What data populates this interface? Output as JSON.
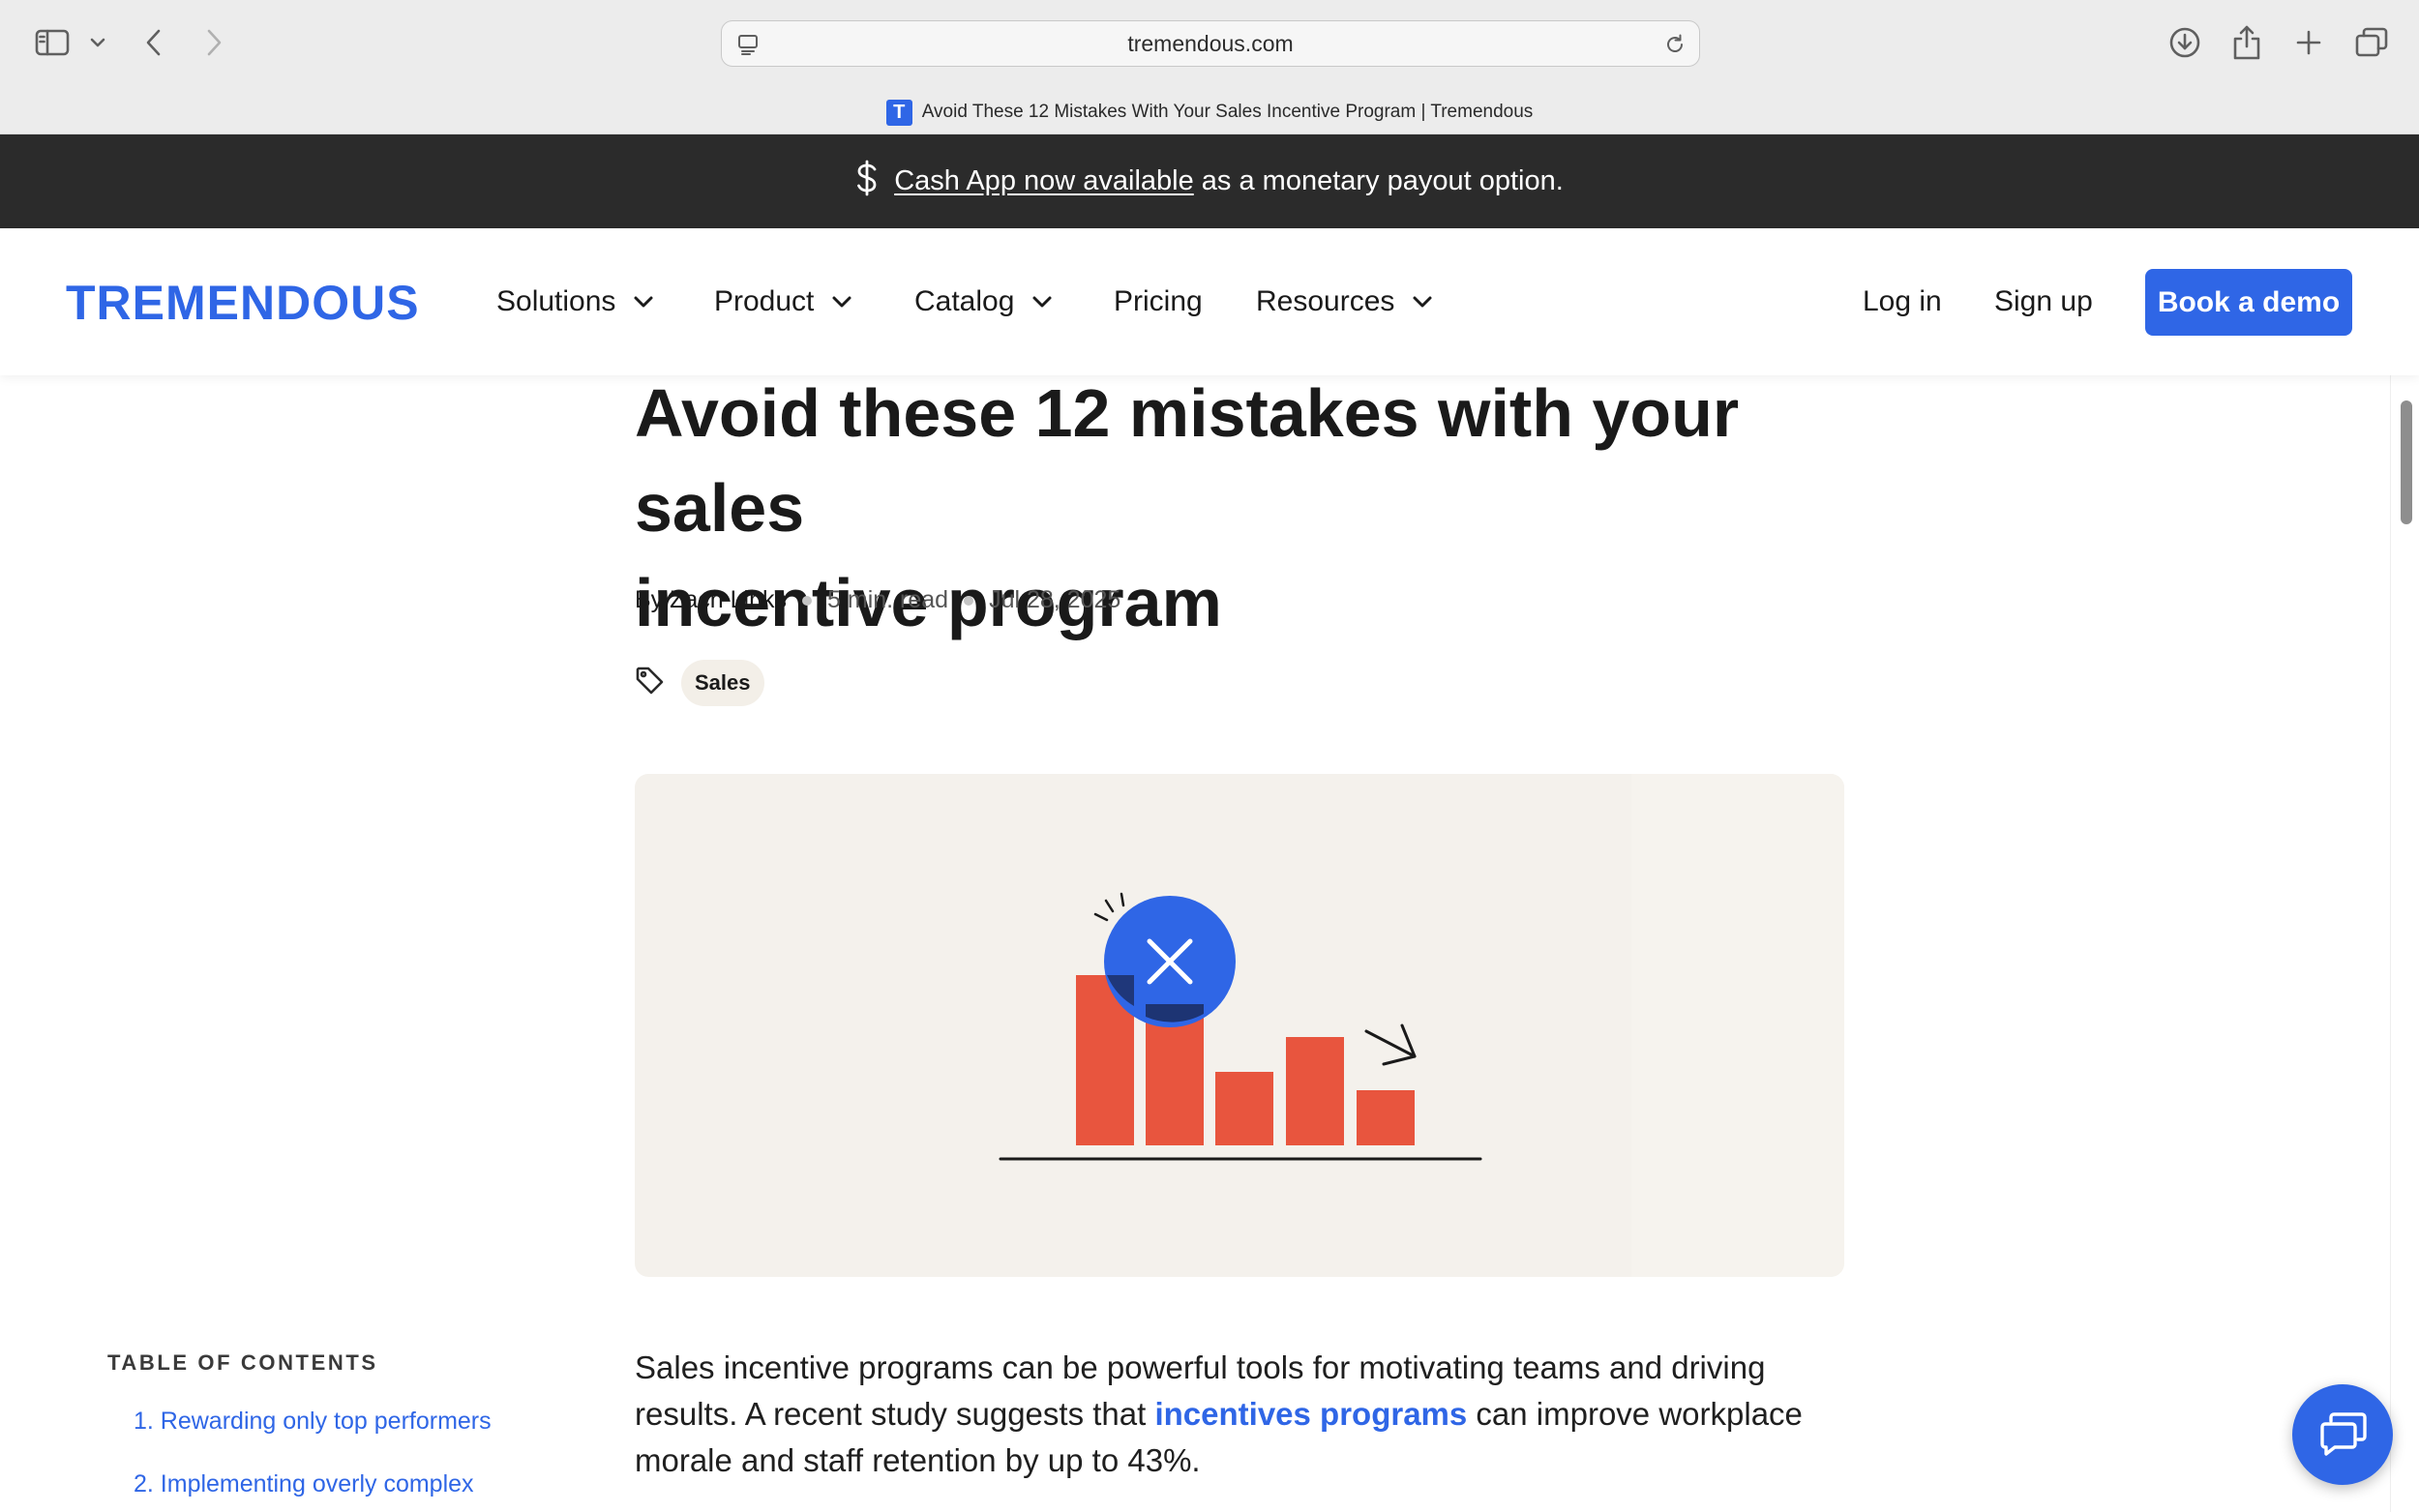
{
  "browser": {
    "url": "tremendous.com",
    "tab_title": "Avoid These 12 Mistakes With Your Sales Incentive Program | Tremendous",
    "tab_favicon": "T"
  },
  "announcement": {
    "icon": "dollar-icon",
    "link_text": "Cash App now available",
    "rest_text": "as a monetary payout option."
  },
  "nav": {
    "logo": "TREMENDOUS",
    "items": [
      {
        "label": "Solutions"
      },
      {
        "label": "Product"
      },
      {
        "label": "Catalog"
      },
      {
        "label": "Pricing"
      },
      {
        "label": "Resources"
      }
    ],
    "login": "Log in",
    "signup": "Sign up",
    "demo": "Book a demo"
  },
  "article": {
    "title_line1": "Avoid these 12 mistakes with your sales",
    "title_line2": "incentive program",
    "author": "By Zach Links",
    "read_time": "5 min. read",
    "date": "Jul 28, 2025",
    "tag": "Sales",
    "intro_before": "Sales incentive programs can be powerful tools for motivating teams and driving results. A recent study suggests that ",
    "intro_link": "incentives programs",
    "intro_after": " can improve workplace morale and staff retention by up to 43%."
  },
  "toc": {
    "title": "TABLE OF CONTENTS",
    "items": [
      "1. Rewarding only top performers",
      "2. Implementing overly complex"
    ]
  },
  "colors": {
    "brand_blue": "#2f66e6",
    "announce_bg": "#2b2b2b",
    "hero_bg": "#f4f1ec",
    "bar_red": "#e8553e"
  }
}
